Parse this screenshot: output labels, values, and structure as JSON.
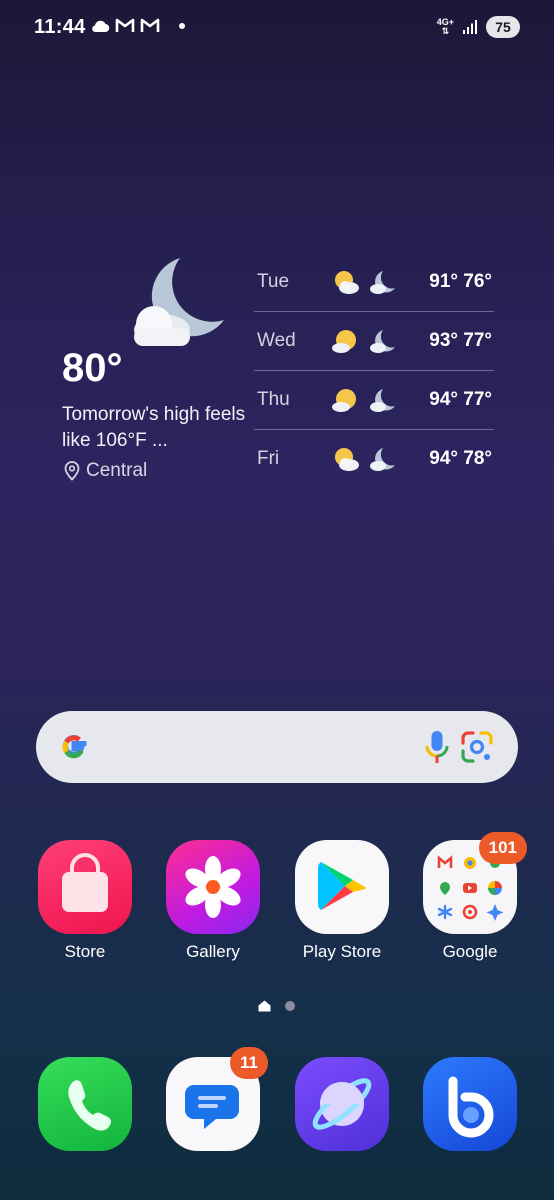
{
  "status_bar": {
    "time": "11:44",
    "network_type": "4G+",
    "battery": "75",
    "notification_icons": [
      "cloud-icon",
      "gmail-icon",
      "gmail-icon",
      "dot-icon"
    ]
  },
  "weather": {
    "current_temp": "80°",
    "description": "Tomorrow's high feels like 106°F ...",
    "location": "Central",
    "forecast": [
      {
        "day": "Tue",
        "temps": "91° 76°"
      },
      {
        "day": "Wed",
        "temps": "93° 77°"
      },
      {
        "day": "Thu",
        "temps": "94° 77°"
      },
      {
        "day": "Fri",
        "temps": "94° 78°"
      }
    ]
  },
  "search": {
    "logo": "google-g-icon",
    "actions": [
      "microphone-icon",
      "google-lens-icon"
    ]
  },
  "apps": [
    {
      "label": "Store",
      "icon": "store-bag-icon"
    },
    {
      "label": "Gallery",
      "icon": "gallery-flower-icon"
    },
    {
      "label": "Play Store",
      "icon": "play-store-icon"
    },
    {
      "label": "Google",
      "icon": "google-folder-icon",
      "badge": "101"
    }
  ],
  "page_indicator": {
    "pages": 2,
    "current": 1
  },
  "dock": [
    {
      "app": "Phone",
      "icon": "phone-icon"
    },
    {
      "app": "Messages",
      "icon": "messages-icon",
      "badge": "11"
    },
    {
      "app": "Internet",
      "icon": "internet-browser-icon"
    },
    {
      "app": "Bixby",
      "icon": "bixby-icon"
    }
  ],
  "colors": {
    "badge": "#ec5a2a",
    "search_bar": "#e6e8ee"
  }
}
